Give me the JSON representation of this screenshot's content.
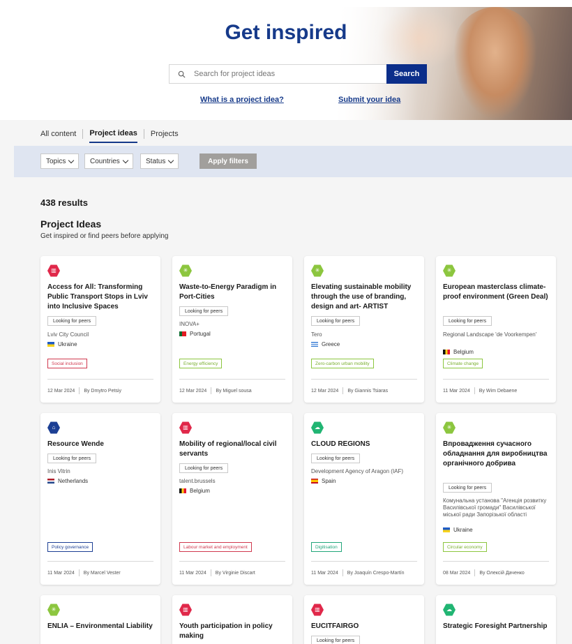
{
  "hero": {
    "title": "Get inspired",
    "search_placeholder": "Search for project ideas",
    "search_button": "Search",
    "link_what": "What is a project idea?",
    "link_submit": "Submit your idea"
  },
  "tabs": [
    {
      "label": "All content",
      "active": false
    },
    {
      "label": "Project ideas",
      "active": true
    },
    {
      "label": "Projects",
      "active": false
    }
  ],
  "filters": {
    "topics": "Topics",
    "countries": "Countries",
    "status": "Status",
    "apply": "Apply filters"
  },
  "results": {
    "count": "438 results",
    "section_title": "Project Ideas",
    "section_subtitle": "Get inspired or find peers before applying"
  },
  "colors": {
    "brand_blue": "#163a8a",
    "icon_red": "#e0284a",
    "icon_green": "#8cc63f",
    "icon_blue": "#1c3f94",
    "icon_teal": "#21b573",
    "tag_red": "#d0384e",
    "tag_green": "#8cc63f",
    "tag_blue": "#1c3f94",
    "tag_teal": "#21a67a"
  },
  "cards": [
    {
      "icon": "building-icon",
      "title": "Access for All: Transforming Public Transport Stops in Lviv into Inclusive Spaces",
      "status": "Looking for peers",
      "org": "Lviv City Council",
      "country": "Ukraine",
      "tag": "Social inclusion",
      "date": "12 Mar 2024",
      "author": "By Dmytro Petsiy"
    },
    {
      "icon": "plant-icon",
      "title": "Waste-to-Energy Paradigm in Port-Cities",
      "status": "Looking for peers",
      "org": "INOVA+",
      "country": "Portugal",
      "tag": "Energy efficiency",
      "date": "12 Mar 2024",
      "author": "By Miguel sousa"
    },
    {
      "icon": "plant-icon",
      "title": "Elevating sustainable mobility through the use of branding, design and art- ARTIST",
      "status": "Looking for peers",
      "org": "Tero",
      "country": "Greece",
      "tag": "Zero-carbon urban mobility",
      "date": "12 Mar 2024",
      "author": "By Giannis Tsiaras"
    },
    {
      "icon": "plant-icon",
      "title": "European masterclass climate-proof environment (Green Deal)",
      "status": "Looking for peers",
      "org": "Regional Landscape 'de Voorkempen'",
      "country": "Belgium",
      "tag": "Climate change",
      "date": "11 Mar 2024",
      "author": "By Wim Debaene"
    },
    {
      "icon": "institution-icon",
      "title": "Resource Wende",
      "status": "Looking for peers",
      "org": "Inis Vitrin",
      "country": "Netherlands",
      "tag": "Policy governance",
      "date": "11 Mar 2024",
      "author": "By Marcel Vester"
    },
    {
      "icon": "building-icon",
      "title": "Mobility of regional/local civil servants",
      "status": "Looking for peers",
      "org": "talent.brussels",
      "country": "Belgium",
      "tag": "Labour market and employment",
      "date": "11 Mar 2024",
      "author": "By Virginie Discart"
    },
    {
      "icon": "cloud-icon",
      "title": "CLOUD REGIONS",
      "status": "Looking for peers",
      "org": "Development Agency of Aragon (IAF)",
      "country": "Spain",
      "tag": "Digitisation",
      "date": "11 Mar 2024",
      "author": "By Joaquín Crespo-Martín"
    },
    {
      "icon": "plant-icon",
      "title": "Впровадження сучасного обладнання для виробництва органічного добрива",
      "status": "Looking for peers",
      "org": "Комунальна установа \"Агенція розвитку Василівської громади\" Василівської міської ради Запорізької області",
      "country": "Ukraine",
      "tag": "Circular economy",
      "date": "08 Mar 2024",
      "author": "By Олексій Даченко"
    },
    {
      "icon": "plant-icon",
      "title": "ENLIA – Environmental Liability",
      "status": "",
      "org": "",
      "country": "",
      "tag": "",
      "date": "",
      "author": ""
    },
    {
      "icon": "building-icon",
      "title": "Youth participation in policy making",
      "status": "",
      "org": "",
      "country": "",
      "tag": "",
      "date": "",
      "author": ""
    },
    {
      "icon": "building-icon",
      "title": "EUCITFAIRGO",
      "status": "Looking for peers",
      "org": "",
      "country": "",
      "tag": "",
      "date": "",
      "author": ""
    },
    {
      "icon": "cloud-icon",
      "title": "Strategic Foresight Partnership",
      "status": "",
      "org": "",
      "country": "",
      "tag": "",
      "date": "",
      "author": ""
    }
  ]
}
